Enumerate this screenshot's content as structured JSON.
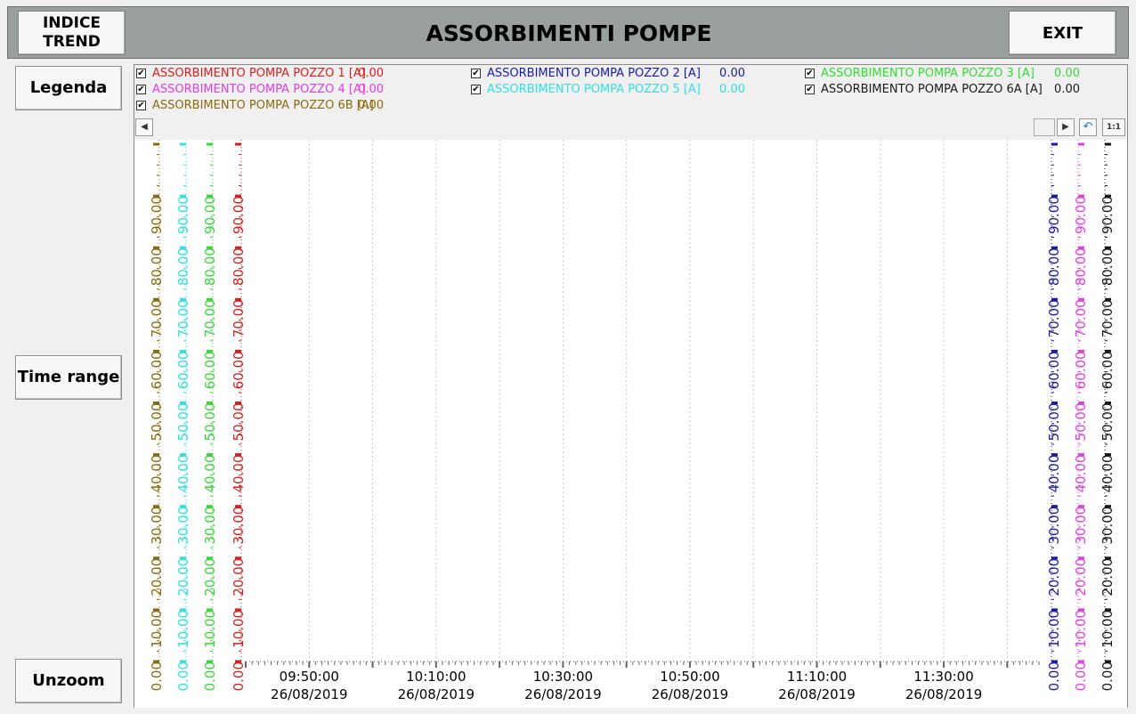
{
  "header": {
    "title": "ASSORBIMENTI POMPE",
    "indice_trend": [
      "INDICE",
      "TREND"
    ],
    "exit_label": "EXIT"
  },
  "side": {
    "legenda_label": "Legenda",
    "time_range_label": "Time range",
    "unzoom_label": "Unzoom"
  },
  "legend": [
    {
      "label": "ASSORBIMENTO POMPA POZZO 1 [A]",
      "value": "0.00",
      "color": "#d42020",
      "checked": true
    },
    {
      "label": "ASSORBIMENTO POMPA POZZO 2 [A]",
      "value": "0.00",
      "color": "#1a1aa8",
      "checked": true
    },
    {
      "label": "ASSORBIMENTO POMPA POZZO 3 [A]",
      "value": "0.00",
      "color": "#38d838",
      "checked": true
    },
    {
      "label": "ASSORBIMENTO POMPA POZZO 4 [A]",
      "value": "0.00",
      "color": "#e040e0",
      "checked": true
    },
    {
      "label": "ASSORBIMENTO POMPA POZZO 5 [A]",
      "value": "0.00",
      "color": "#30e0e0",
      "checked": true
    },
    {
      "label": "ASSORBIMENTO POMPA POZZO 6A [A]",
      "value": "0.00",
      "color": "#1a1a1a",
      "checked": true
    },
    {
      "label": "ASSORBIMENTO POMPA POZZO 6B [A]",
      "value": "0.00",
      "color": "#8a6a10",
      "checked": true
    }
  ],
  "scroll": {
    "left_icon": "scroll-left-arrow",
    "right_icon": "scroll-right-arrow",
    "undo_icon": "undo-zoom-icon",
    "ratio_label": "1:1"
  },
  "chart_data": {
    "type": "line",
    "ylim": [
      0,
      100
    ],
    "y_ticks": [
      "0.00",
      "10.00",
      "20.00",
      "30.00",
      "40.00",
      "50.00",
      "60.00",
      "70.00",
      "80.00",
      "90.00"
    ],
    "x_ticks": [
      {
        "time": "09:50:00",
        "date": "26/08/2019"
      },
      {
        "time": "10:10:00",
        "date": "26/08/2019"
      },
      {
        "time": "10:30:00",
        "date": "26/08/2019"
      },
      {
        "time": "10:50:00",
        "date": "26/08/2019"
      },
      {
        "time": "11:10:00",
        "date": "26/08/2019"
      },
      {
        "time": "11:30:00",
        "date": "26/08/2019"
      }
    ],
    "x_range": [
      "09:40:00",
      "11:45:00"
    ],
    "grid": "vertical-dotted",
    "left_axes": [
      {
        "series": "ASSORBIMENTO POMPA POZZO 6B [A]",
        "color": "#8a6a10"
      },
      {
        "series": "ASSORBIMENTO POMPA POZZO 5 [A]",
        "color": "#30e0e0"
      },
      {
        "series": "ASSORBIMENTO POMPA POZZO 3 [A]",
        "color": "#38d838"
      },
      {
        "series": "ASSORBIMENTO POMPA POZZO 1 [A]",
        "color": "#d42020"
      }
    ],
    "right_axes": [
      {
        "series": "ASSORBIMENTO POMPA POZZO 2 [A]",
        "color": "#1a1aa8"
      },
      {
        "series": "ASSORBIMENTO POMPA POZZO 4 [A]",
        "color": "#e040e0"
      },
      {
        "series": "ASSORBIMENTO POMPA POZZO 6A [A]",
        "color": "#1a1a1a"
      }
    ],
    "series": []
  }
}
